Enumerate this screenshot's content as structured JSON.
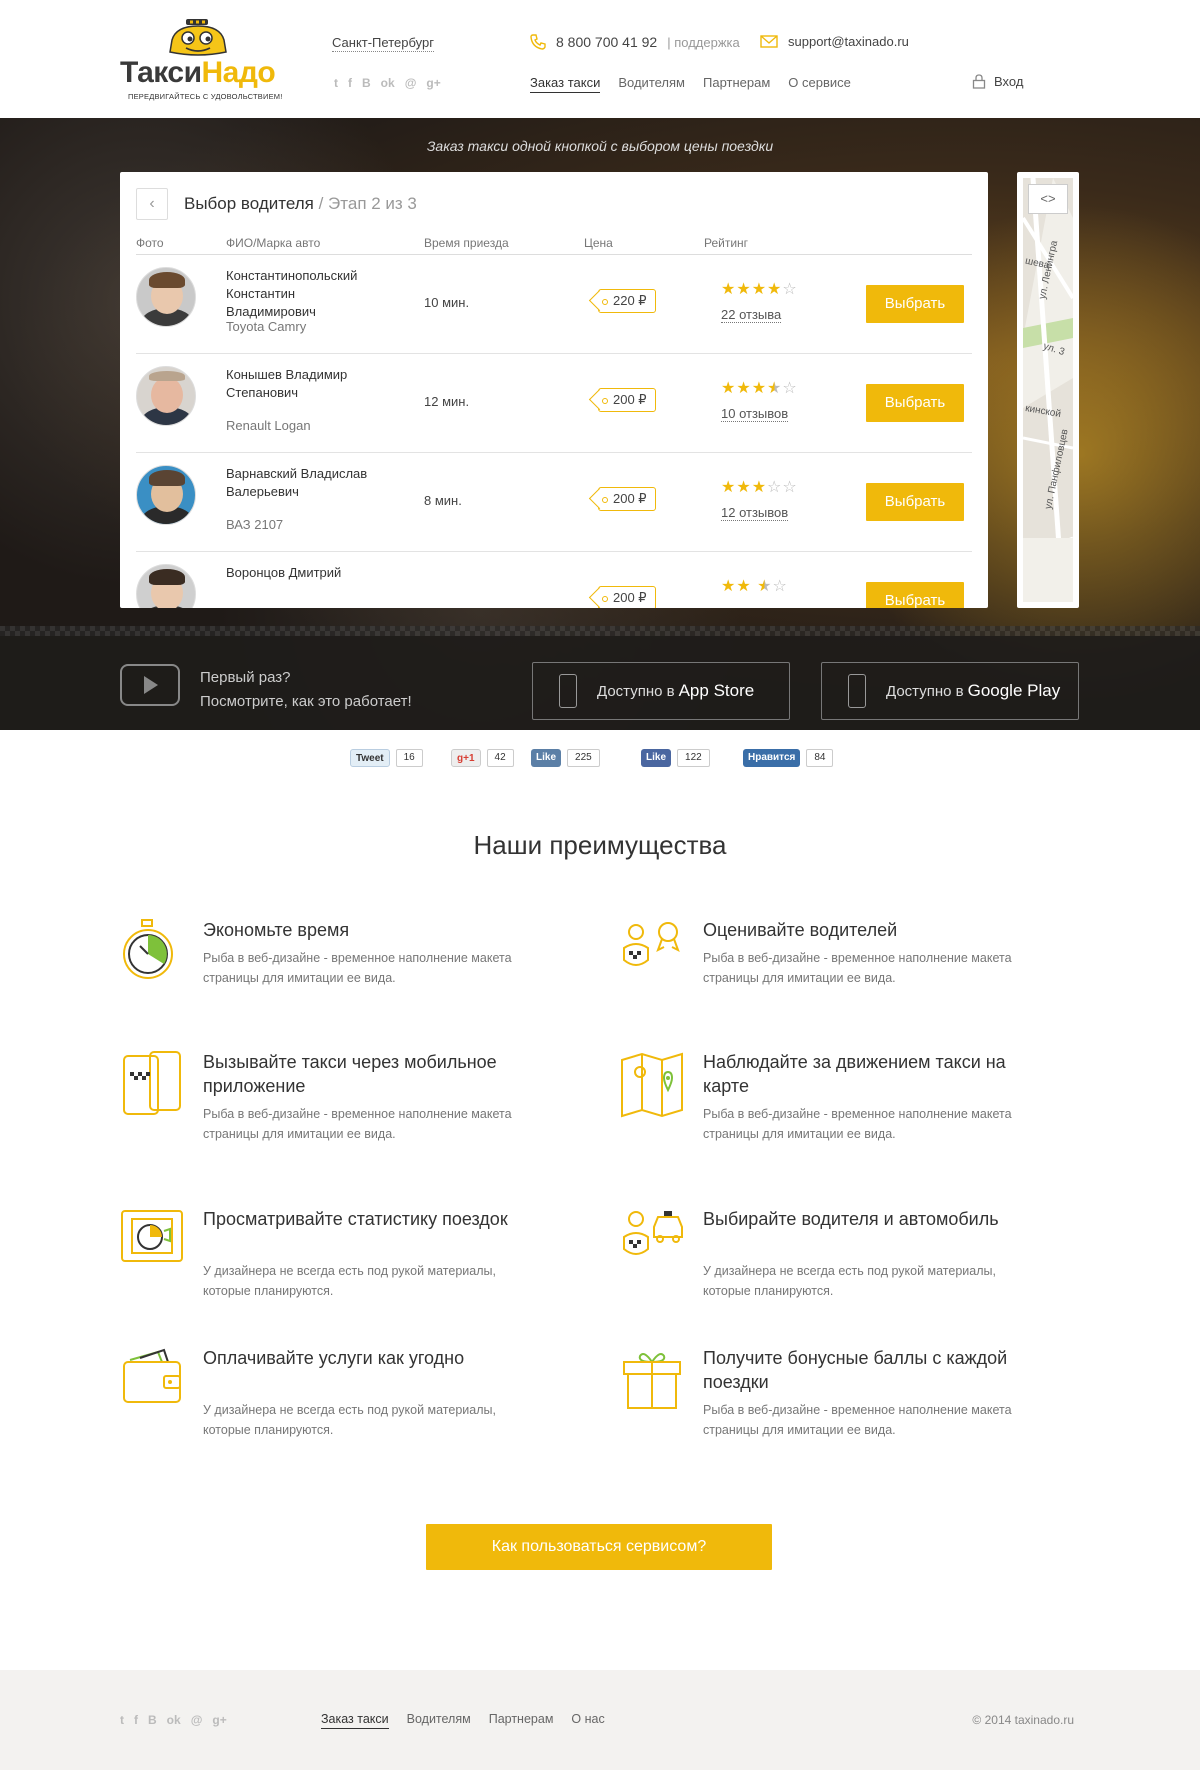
{
  "brand": {
    "name_part1": "Такси",
    "name_part2": "Надо",
    "tagline": "ПЕРЕДВИГАЙТЕСЬ С УДОВОЛЬСТВИЕМ!",
    "accent": "#f0b90b"
  },
  "header": {
    "city": "Санкт-Петербург",
    "phone": "8 800 700 41 92",
    "phone_sub": "| поддержка",
    "email": "support@taxinado.ru",
    "nav": [
      "Заказ такси",
      "Водителям",
      "Партнерам",
      "О сервисе"
    ],
    "login": "Вход",
    "socials": [
      "twitter-icon",
      "facebook-icon",
      "vk-icon",
      "odnoklassniki-icon",
      "mailru-icon",
      "googleplus-icon"
    ]
  },
  "hero": {
    "tagline": "Заказ такси одной кнопкой с выбором цены поездки",
    "panel": {
      "title": "Выбор водителя",
      "step": " / Этап 2 из 3",
      "columns": [
        "Фото",
        "ФИО/Марка авто",
        "Время приезда",
        "Цена",
        "Рейтинг"
      ],
      "select_label": "Выбрать",
      "drivers": [
        {
          "name": "Константинопольский Константин Владимирович",
          "car": "Toyota Camry",
          "time": "10 мин.",
          "price": "220 ₽",
          "rating": 4,
          "reviews": "22 отзыва"
        },
        {
          "name": "Конышев Владимир Степанович",
          "car": "Renault Logan",
          "time": "12 мин.",
          "price": "200 ₽",
          "rating": 3.5,
          "reviews": "10 отзывов"
        },
        {
          "name": "Варнавский Владислав Валерьевич",
          "car": "ВАЗ 2107",
          "time": "8 мин.",
          "price": "200 ₽",
          "rating": 3,
          "reviews": "12 отзывов"
        },
        {
          "name": "Воронцов Дмитрий",
          "car": "",
          "time": "",
          "price": "200 ₽",
          "rating": 2.5,
          "reviews": ""
        }
      ]
    },
    "map": {
      "toggle": "<>",
      "streets": [
        "шева",
        "ул. Ленингра",
        "ул. 3",
        "кинской",
        "ул. Панфиловцев"
      ]
    },
    "promo": {
      "line1": "Первый раз?",
      "line2": "Посмотрите, как это работает!",
      "appstore_prefix": "Доступно в",
      "appstore_name": "App Store",
      "gplay_prefix": "Доступно в",
      "gplay_name": "Google Play"
    }
  },
  "share": [
    {
      "label": "Tweet",
      "count": "16",
      "color": "#e3eef6",
      "text": "#333"
    },
    {
      "label": "g+1",
      "count": "42",
      "color": "#e9e9e9",
      "text": "#d73d32"
    },
    {
      "label": "Like",
      "count": "225",
      "color": "#5b7fa6",
      "text": "#fff"
    },
    {
      "label": "Like",
      "count": "122",
      "color": "#4a66a0",
      "text": "#fff"
    },
    {
      "label": "Нравится",
      "count": "84",
      "color": "#3a6ea8",
      "text": "#fff"
    }
  ],
  "advantages": {
    "title": "Наши преимущества",
    "items": [
      {
        "title": "Экономьте время",
        "text": "Рыба в веб-дизайне - временное наполнение макета страницы для имитации ее вида."
      },
      {
        "title": "Оценивайте водителей",
        "text": "Рыба в веб-дизайне - временное наполнение макета страницы для имитации ее вида."
      },
      {
        "title": "Вызывайте такси через мобильное приложение",
        "text": "Рыба в веб-дизайне - временное наполнение макета страницы для имитации ее вида."
      },
      {
        "title": "Наблюдайте за движением такси на карте",
        "text": "Рыба в веб-дизайне - временное наполнение макета страницы для имитации ее вида."
      },
      {
        "title": "Просматривайте статистику поездок",
        "text": "У дизайнера не всегда есть под рукой материалы, которые планируются."
      },
      {
        "title": "Выбирайте водителя и автомобиль",
        "text": "У дизайнера не всегда есть под рукой материалы, которые планируются."
      },
      {
        "title": "Оплачивайте услуги как угодно",
        "text": "У дизайнера не всегда есть под рукой материалы, которые планируются."
      },
      {
        "title": "Получите бонусные баллы с каждой поездки",
        "text": "Рыба в веб-дизайне - временное наполнение макета страницы для имитации ее вида."
      }
    ],
    "cta": "Как пользоваться сервисом?"
  },
  "footer": {
    "nav": [
      "Заказ такси",
      "Водителям",
      "Партнерам",
      "О нас"
    ],
    "copyright": "© 2014 taxinado.ru"
  }
}
